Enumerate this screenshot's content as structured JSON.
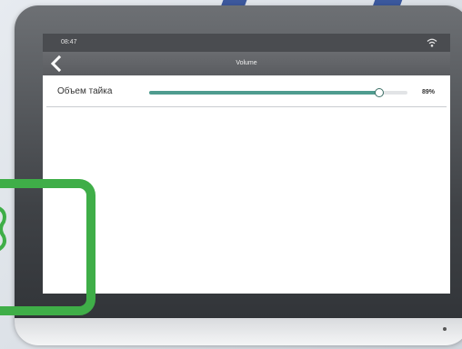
{
  "status_bar": {
    "time": "08:47",
    "wifi_icon": "wifi-icon"
  },
  "title_bar": {
    "title": "Volume",
    "back_icon": "chevron-left-icon"
  },
  "settings": {
    "volume_row": {
      "label": "Объем тайка",
      "value_text": "89%",
      "value": 0.89
    }
  },
  "colors": {
    "slider_fill": "#4f9c8f",
    "frame_green": "#3fae48",
    "status_bar": "#4a4c50",
    "title_bar": "#5a5c60"
  }
}
